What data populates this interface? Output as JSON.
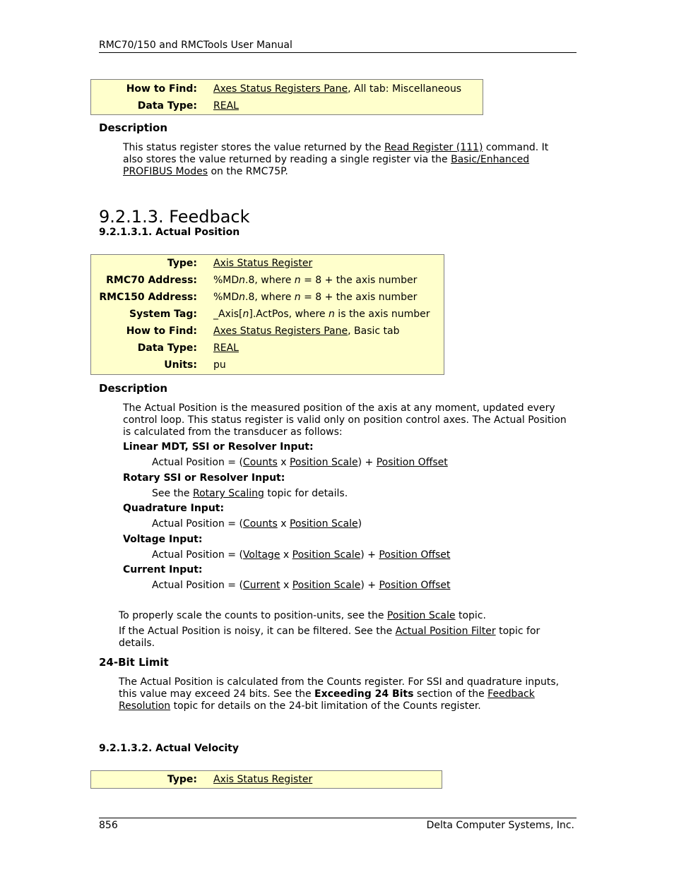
{
  "header": {
    "title": "RMC70/150 and RMCTools User Manual"
  },
  "footer": {
    "page_number": "856",
    "company": "Delta Computer Systems, Inc."
  },
  "top_table": {
    "rows": [
      {
        "label": "How to Find:",
        "link": "Axes Status Registers Pane",
        "rest": ", All tab: Miscellaneous"
      },
      {
        "label": "Data Type:",
        "link": "REAL",
        "rest": ""
      }
    ]
  },
  "top_description": {
    "heading": "Description",
    "t1": "This status register stores the value returned by the ",
    "link1": "Read Register (111)",
    "t2": " command. It also stores the value returned by reading a single register via the ",
    "link2": "Basic/Enhanced PROFIBUS Modes",
    "t3": " on the RMC75P."
  },
  "section": {
    "title": "9.2.1.3. Feedback"
  },
  "actual_position": {
    "title": "9.2.1.3.1. Actual Position",
    "table": {
      "type_label": "Type:",
      "type_link": "Axis Status Register",
      "rmc70_label": "RMC70 Address:",
      "rmc70_a": "%MD",
      "rmc70_n": "n",
      "rmc70_b": ".8, where ",
      "rmc70_n2": "n",
      "rmc70_c": " = 8 + the axis number",
      "rmc150_label": "RMC150 Address:",
      "rmc150_a": "%MD",
      "rmc150_n": "n",
      "rmc150_b": ".8, where ",
      "rmc150_n2": "n",
      "rmc150_c": " = 8 + the axis number",
      "tag_label": "System Tag:",
      "tag_a": "_Axis[",
      "tag_n": "n",
      "tag_b": "].ActPos, where ",
      "tag_n2": "n",
      "tag_c": " is the axis number",
      "find_label": "How to Find:",
      "find_link": "Axes Status Registers Pane",
      "find_rest": ", Basic tab",
      "dtype_label": "Data Type:",
      "dtype_link": "REAL",
      "units_label": "Units:",
      "units_value": "pu"
    },
    "description": {
      "heading": "Description",
      "intro": "The Actual Position is the measured position of the axis at any moment, updated every control loop. This status register is valid only on position control axes. The Actual Position is calculated from the transducer as follows:",
      "linear_label": "Linear MDT, SSI or Resolver Input:",
      "rotary_label": "Rotary SSI or Resolver Input:",
      "rotary_t1": "See the ",
      "rotary_link": "Rotary Scaling",
      "rotary_t2": " topic for details.",
      "quad_label": "Quadrature Input:",
      "voltage_label": "Voltage Input:",
      "current_label": "Current Input:",
      "formula_prefix": "Actual Position = (",
      "times": " x ",
      "close": ")",
      "plus": ") + ",
      "counts": "Counts",
      "voltage": "Voltage",
      "current": "Current",
      "position_scale": "Position Scale",
      "position_offset": "Position Offset",
      "scale_t1": "To properly scale the counts to position-units, see the ",
      "scale_link": "Position Scale",
      "scale_t2": " topic.",
      "filter_t1": "If the Actual Position is noisy, it can be filtered. See the ",
      "filter_link": "Actual Position Filter",
      "filter_t2": " topic for details."
    },
    "limit": {
      "heading": "24-Bit Limit",
      "t1": "The Actual Position is calculated from the Counts register. For SSI and quadrature inputs, this value may exceed 24 bits. See the ",
      "bold": "Exceeding 24 Bits",
      "t2": " section of the ",
      "link": "Feedback Resolution",
      "t3": " topic for details on the 24-bit limitation of the Counts register."
    }
  },
  "actual_velocity": {
    "title": "9.2.1.3.2. Actual Velocity",
    "type_label": "Type:",
    "type_link": "Axis Status Register"
  }
}
